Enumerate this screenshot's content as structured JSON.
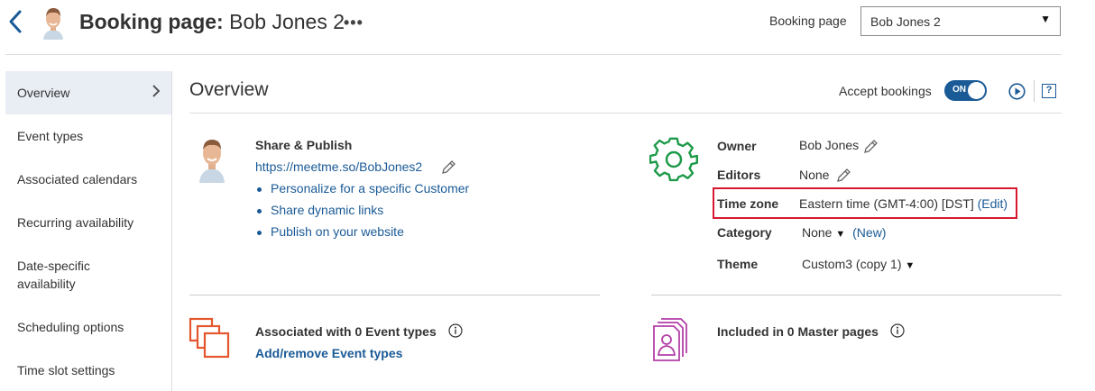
{
  "header": {
    "title_prefix": "Booking page:",
    "title_name": "Bob Jones 2",
    "more_label": "•••",
    "booking_page_label": "Booking page",
    "booking_page_selected": "Bob Jones 2"
  },
  "sidebar": {
    "items": [
      {
        "label": "Overview",
        "active": true
      },
      {
        "label": "Event types"
      },
      {
        "label": "Associated calendars"
      },
      {
        "label": "Recurring availability"
      },
      {
        "label": "Date-specific availability"
      },
      {
        "label": "Scheduling options"
      },
      {
        "label": "Time slot settings"
      }
    ]
  },
  "overview": {
    "title": "Overview",
    "accept_bookings_label": "Accept bookings",
    "toggle_label": "ON",
    "toggle_on": true,
    "help_label": "?"
  },
  "share": {
    "title": "Share & Publish",
    "url": "https://meetme.so/BobJones2",
    "links": [
      "Personalize for a specific Customer",
      "Share dynamic links",
      "Publish on your website"
    ]
  },
  "settings": {
    "owner_label": "Owner",
    "owner_value": "Bob Jones",
    "editors_label": "Editors",
    "editors_value": "None",
    "timezone_label": "Time zone",
    "timezone_value": "Eastern time (GMT-4:00) [DST]",
    "timezone_edit_link": "(Edit)",
    "category_label": "Category",
    "category_value": "None",
    "category_new_link": "(New)",
    "theme_label": "Theme",
    "theme_value": "Custom3 (copy 1)"
  },
  "associated": {
    "title": "Associated with 0 Event types",
    "link": "Add/remove Event types"
  },
  "master": {
    "title": "Included in 0 Master pages"
  },
  "colors": {
    "link": "#1a5a96",
    "toggle_on": "#1a5a96",
    "gear_icon": "#1e9a4a",
    "event_types_icon": "#e4572e",
    "master_pages_icon": "#b43fa8",
    "highlight": "#d6192f"
  }
}
